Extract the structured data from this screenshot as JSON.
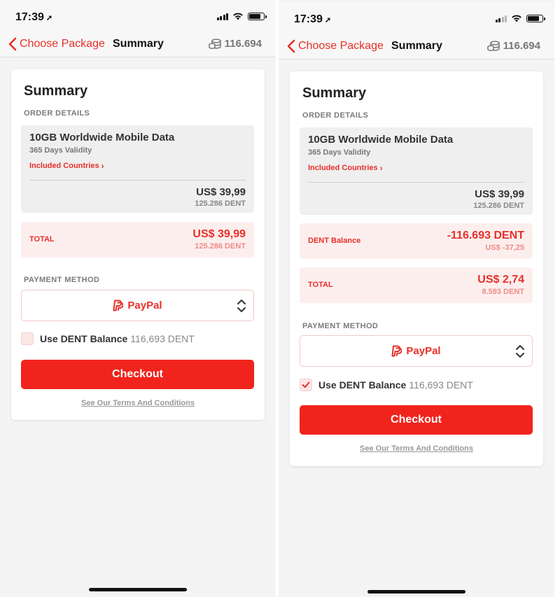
{
  "left_screen": {
    "status_time": "17:39",
    "nav": {
      "back_label": "Choose Package",
      "title": "Summary",
      "balance": "116.694"
    },
    "card": {
      "title": "Summary",
      "order_details_label": "ORDER DETAILS",
      "package": {
        "name": "10GB Worldwide Mobile Data",
        "validity": "365 Days Validity",
        "countries_link": "Included Countries",
        "price_usd": "US$ 39,99",
        "price_dent": "125.286 DENT"
      },
      "total": {
        "label": "TOTAL",
        "usd": "US$ 39,99",
        "dent": "125.286 DENT"
      },
      "payment_method_label": "PAYMENT METHOD",
      "payment_method_value": "PayPal",
      "use_dent": {
        "checked": false,
        "label": "Use DENT Balance",
        "amount": "116,693 DENT"
      },
      "checkout_label": "Checkout",
      "terms_label": "See Our Terms And Conditions"
    }
  },
  "right_screen": {
    "status_time": "17:39",
    "nav": {
      "back_label": "Choose Package",
      "title": "Summary",
      "balance": "116.694"
    },
    "card": {
      "title": "Summary",
      "order_details_label": "ORDER DETAILS",
      "package": {
        "name": "10GB Worldwide Mobile Data",
        "validity": "365 Days Validity",
        "countries_link": "Included Countries",
        "price_usd": "US$ 39,99",
        "price_dent": "125.286 DENT"
      },
      "dent_balance": {
        "label": "DENT Balance",
        "amount": "-116.693 DENT",
        "usd": "US$ -37,25"
      },
      "total": {
        "label": "TOTAL",
        "usd": "US$ 2,74",
        "dent": "8.593 DENT"
      },
      "payment_method_label": "PAYMENT METHOD",
      "payment_method_value": "PayPal",
      "use_dent": {
        "checked": true,
        "label": "Use DENT Balance",
        "amount": "116,693 DENT"
      },
      "checkout_label": "Checkout",
      "terms_label": "See Our Terms And Conditions"
    }
  },
  "colors": {
    "accent": "#e7302a",
    "button": "#f0241d",
    "pink_bg": "#fdeeee",
    "grey_box": "#efefef"
  },
  "icons": [
    "location-arrow-icon",
    "signal-icon",
    "wifi-icon",
    "battery-icon",
    "back-chevron-icon",
    "coins-icon",
    "chevron-right-icon",
    "paypal-icon",
    "updown-chevron-icon",
    "checkmark-icon"
  ]
}
